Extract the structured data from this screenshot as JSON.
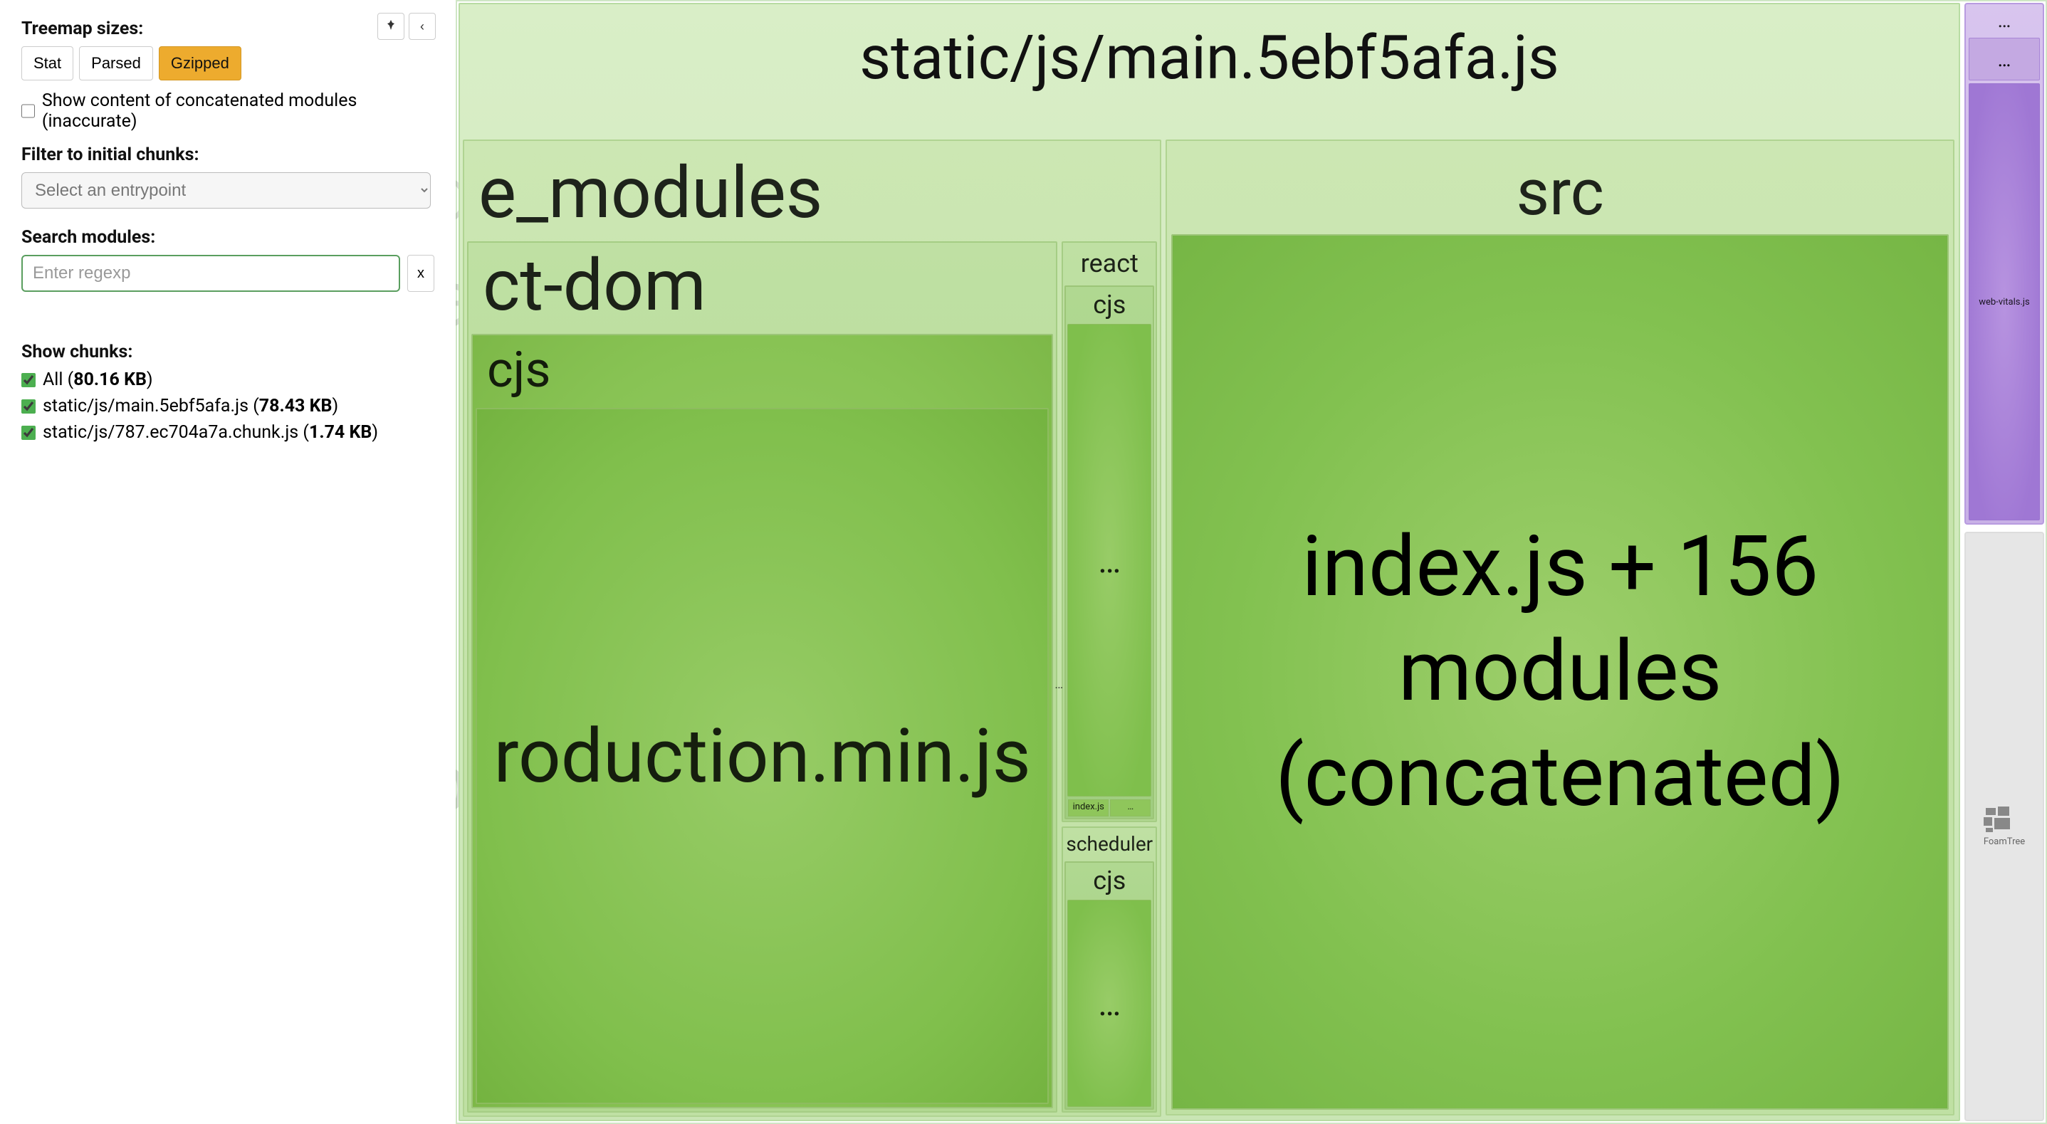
{
  "sidebar": {
    "treemap_sizes_label": "Treemap sizes:",
    "size_buttons": {
      "stat": "Stat",
      "parsed": "Parsed",
      "gzipped": "Gzipped"
    },
    "show_concat_label": "Show content of concatenated modules (inaccurate)",
    "filter_label": "Filter to initial chunks:",
    "entry_placeholder": "Select an entrypoint",
    "search_label": "Search modules:",
    "search_placeholder": "Enter regexp",
    "clear_symbol": "x",
    "show_chunks_label": "Show chunks:",
    "pin_icon": "📌",
    "collapse_icon": "‹",
    "chunks": [
      {
        "label": "All",
        "size": "80.16 KB"
      },
      {
        "label": "static/js/main.5ebf5afa.js",
        "size": "78.43 KB"
      },
      {
        "label": "static/js/787.ec704a7a.chunk.js",
        "size": "1.74 KB"
      }
    ]
  },
  "ghosts": {
    "node_modules": "node_modules",
    "react_dom": "react-dom",
    "prod_min": "react-dom.production.min.js"
  },
  "treemap": {
    "main_title": "static/js/main.5ebf5afa.js",
    "node_modules": "e_modules",
    "react_dom": "ct-dom",
    "cjs": "cjs",
    "prod_min": "roduction.min.js",
    "react": "react",
    "react_cjs": "cjs",
    "react_dots": "…",
    "react_tiny1": "index.js",
    "react_tiny2": "…",
    "col_dots": "…",
    "scheduler": "scheduler",
    "scheduler_cjs": "cjs",
    "scheduler_dots": "…",
    "src": "src",
    "index_modules": "index.js + 156 modules (concatenated)",
    "chunk2_title": "…",
    "chunk2_sub": "…",
    "chunk2_main": "web-vitals.js",
    "foamtree": "FoamTree"
  }
}
